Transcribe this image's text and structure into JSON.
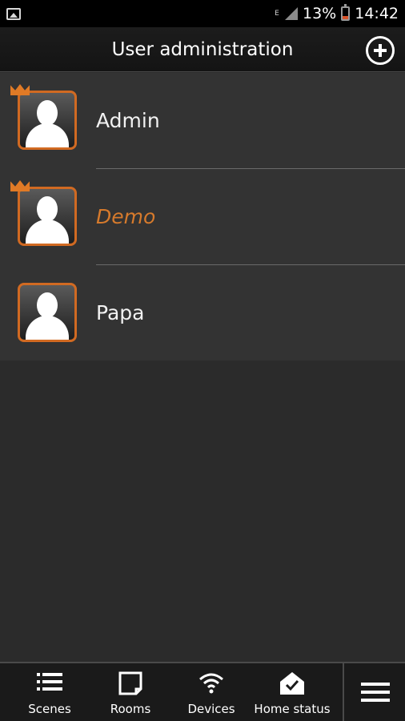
{
  "status_bar": {
    "network_type": "E",
    "battery_percent": "13%",
    "time": "14:42",
    "battery_level": 0.13,
    "icons": [
      "gallery-icon",
      "signal-icon",
      "battery-icon"
    ]
  },
  "header": {
    "title": "User administration",
    "add_icon": "plus-circle-icon"
  },
  "users": [
    {
      "name": "Admin",
      "admin": true,
      "selected": false
    },
    {
      "name": "Demo",
      "admin": true,
      "selected": true
    },
    {
      "name": "Papa",
      "admin": false,
      "selected": false
    }
  ],
  "bottom_nav": {
    "items": [
      {
        "label": "Scenes",
        "icon": "list-icon"
      },
      {
        "label": "Rooms",
        "icon": "door-icon"
      },
      {
        "label": "Devices",
        "icon": "wifi-icon"
      },
      {
        "label": "Home status",
        "icon": "home-check-icon"
      }
    ],
    "menu_icon": "hamburger-menu-icon"
  },
  "colors": {
    "accent": "#d16a22",
    "background": "#2b2b2b",
    "list_background": "#333333",
    "status_bar": "#000000"
  }
}
